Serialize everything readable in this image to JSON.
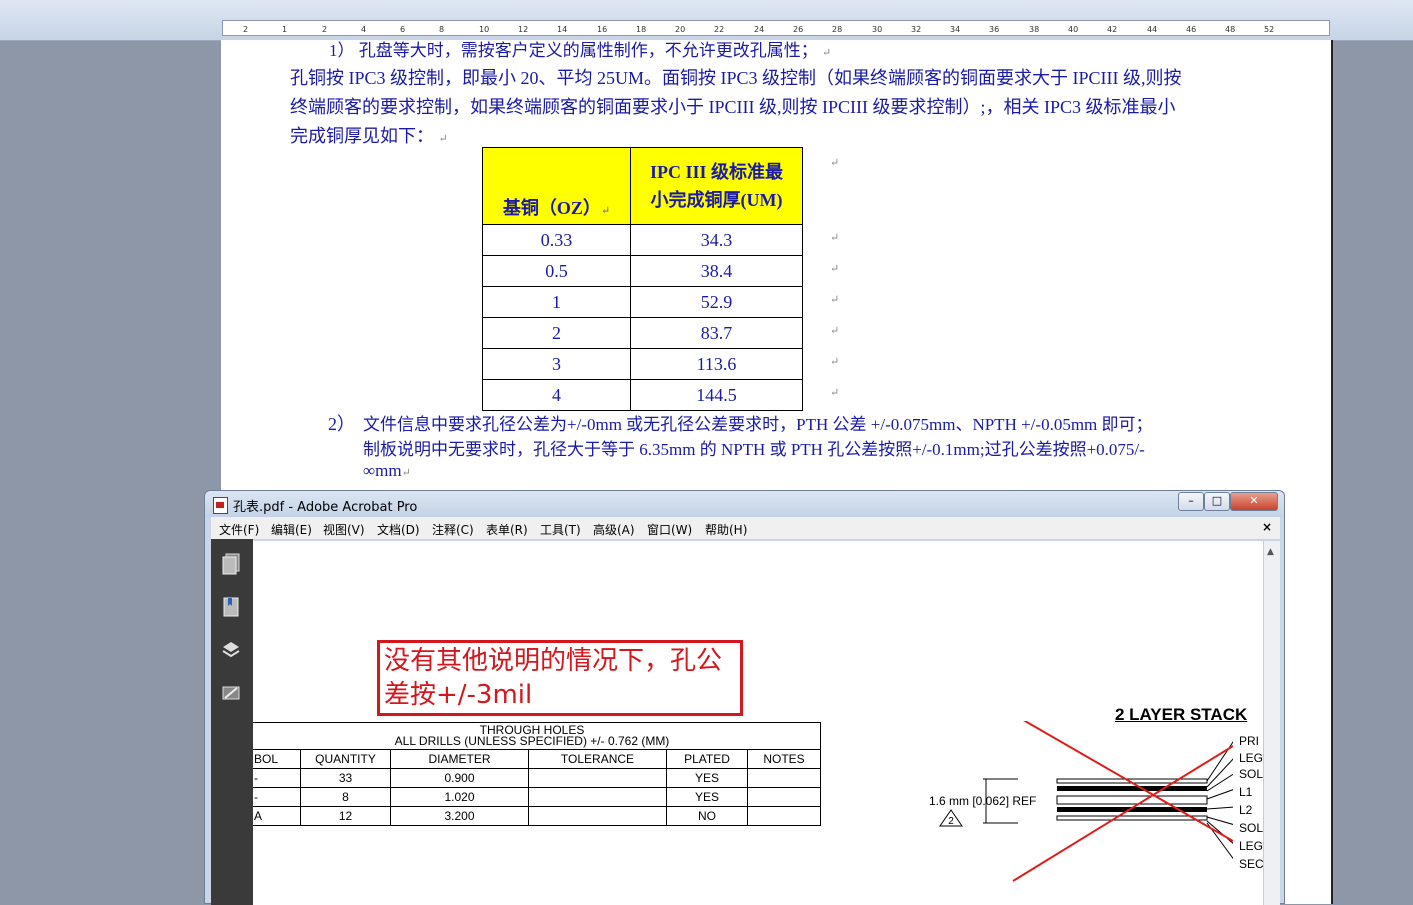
{
  "ruler": {
    "labels": [
      "2",
      "1",
      "2",
      "4",
      "6",
      "8",
      "10",
      "12",
      "14",
      "16",
      "18",
      "20",
      "22",
      "24",
      "26",
      "28",
      "30",
      "32",
      "34",
      "36",
      "38",
      "40",
      "42",
      "44",
      "46",
      "48",
      "52"
    ]
  },
  "document": {
    "item1": "1）  孔盘等大时，需按客户定义的属性制作，不允许更改孔属性；",
    "para": [
      "孔铜按 IPC3 级控制，即最小 20、平均 25UM。面铜按 IPC3 级控制（如果终端顾客的铜面要求大于 IPCIII 级,则按",
      "终端顾客的要求控制，如果终端顾客的铜面要求小于 IPCIII 级,则按 IPCIII 级要求控制）;，相关 IPC3 级标准最小",
      "完成铜厚见如下："
    ],
    "table": {
      "headers": [
        "基铜（OZ）",
        "IPC III 级标准最小完成铜厚(UM)"
      ],
      "rows": [
        [
          "0.33",
          "34.3"
        ],
        [
          "0.5",
          "38.4"
        ],
        [
          "1",
          "52.9"
        ],
        [
          "2",
          "83.7"
        ],
        [
          "3",
          "113.6"
        ],
        [
          "4",
          "144.5"
        ]
      ]
    },
    "item2_number": "2）",
    "item2_lines": [
      "文件信息中要求孔径公差为+/-0mm 或无孔径公差要求时，PTH 公差 +/-0.075mm、NPTH +/-0.05mm 即可；",
      "制板说明中无要求时，孔径大于等于 6.35mm 的 NPTH 或 PTH 孔公差按照+/-0.1mm;过孔公差按照+0.075/-",
      "∞mm"
    ]
  },
  "acrobat": {
    "title": "孔表.pdf - Adobe Acrobat Pro",
    "menu": [
      "文件(F)",
      "编辑(E)",
      "视图(V)",
      "文档(D)",
      "注释(C)",
      "表单(R)",
      "工具(T)",
      "高级(A)",
      "窗口(W)",
      "帮助(H)"
    ],
    "note_line1": "没有其他说明的情况下，孔公",
    "note_line2": "差按+/-3mil",
    "holes": {
      "caption1": "THROUGH HOLES",
      "caption2": "ALL DRILLS (UNLESS SPECIFIED) +/- 0.762 (MM)",
      "headers": [
        "BOL",
        "QUANTITY",
        "DIAMETER",
        "TOLERANCE",
        "PLATED",
        "NOTES"
      ],
      "rows": [
        [
          "-",
          "33",
          "0.900",
          "",
          "YES",
          ""
        ],
        [
          "-",
          "8",
          "1.020",
          "",
          "YES",
          ""
        ],
        [
          "A",
          "12",
          "3.200",
          "",
          "NO",
          ""
        ]
      ]
    },
    "stackup": {
      "title": "2 LAYER STACK",
      "thickness": "1.6 mm [0.062] REF",
      "note_num": "2",
      "labels": [
        "PRI",
        "LEG",
        "SOL",
        "L1",
        "L2",
        "SOL",
        "LEG",
        "SEC"
      ]
    }
  }
}
